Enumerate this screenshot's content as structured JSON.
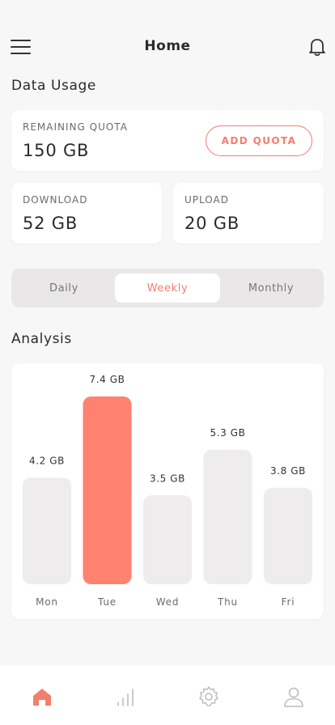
{
  "header": {
    "title": "Home",
    "menu_icon": "hamburger-menu-icon",
    "notification_icon": "bell-icon"
  },
  "data_usage": {
    "title": "Data Usage",
    "remaining_quota": {
      "label": "REMAINING QUOTA",
      "value": "150 GB"
    },
    "add_quota_label": "ADD QUOTA",
    "download": {
      "label": "DOWNLOAD",
      "value": "52 GB"
    },
    "upload": {
      "label": "UPLOAD",
      "value": "20 GB"
    }
  },
  "period_tabs": {
    "items": [
      "Daily",
      "Weekly",
      "Monthly"
    ],
    "selected": "Weekly"
  },
  "analysis": {
    "title": "Analysis"
  },
  "chart_data": {
    "type": "bar",
    "categories": [
      "Mon",
      "Tue",
      "Wed",
      "Thu",
      "Fri"
    ],
    "values": [
      4.2,
      7.4,
      3.5,
      5.3,
      3.8
    ],
    "value_labels": [
      "4.2 GB",
      "7.4 GB",
      "3.5 GB",
      "5.3 GB",
      "3.8 GB"
    ],
    "highlighted_category": "Tue",
    "colors": {
      "bar": "#eeecec",
      "highlight": "#ff8170"
    }
  },
  "bottom_nav": {
    "items": [
      {
        "icon": "home-icon",
        "active": true
      },
      {
        "icon": "bar-chart-icon",
        "active": false
      },
      {
        "icon": "gear-icon",
        "active": false
      },
      {
        "icon": "user-icon",
        "active": false
      }
    ]
  },
  "colors": {
    "accent": "#f47e6e",
    "background": "#f7f7f7",
    "card": "#ffffff"
  }
}
